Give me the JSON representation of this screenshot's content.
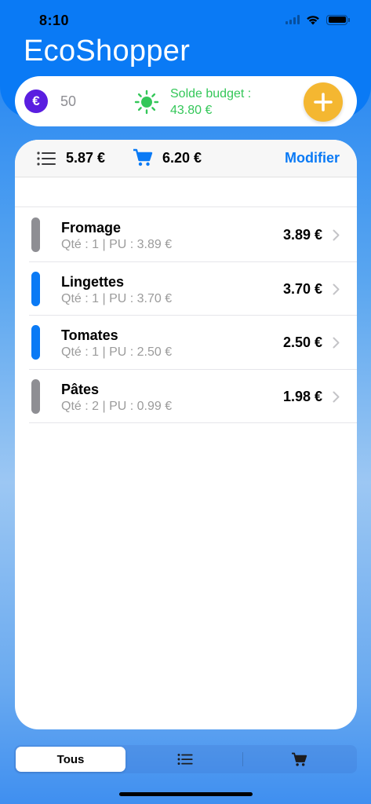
{
  "status": {
    "time": "8:10"
  },
  "app": {
    "title": "EcoShopper"
  },
  "budget": {
    "currency_symbol": "€",
    "amount": "50",
    "balance_label": "Solde budget :",
    "balance_value": "43.80 €"
  },
  "totals": {
    "list_total": "5.87 €",
    "cart_total": "6.20 €",
    "edit_label": "Modifier"
  },
  "items": [
    {
      "name": "Fromage",
      "detail": "Qté : 1  |  PU : 3.89 €",
      "price": "3.89 €",
      "color": "#8e8e93"
    },
    {
      "name": "Lingettes",
      "detail": "Qté : 1  |  PU : 3.70 €",
      "price": "3.70 €",
      "color": "#0a7af5"
    },
    {
      "name": "Tomates",
      "detail": "Qté : 1  |  PU : 2.50 €",
      "price": "2.50 €",
      "color": "#0a7af5"
    },
    {
      "name": "Pâtes",
      "detail": "Qté : 2  |  PU : 0.99 €",
      "price": "1.98 €",
      "color": "#8e8e93"
    }
  ],
  "tabs": {
    "all_label": "Tous"
  },
  "colors": {
    "accent": "#0a7af5",
    "success": "#34c759",
    "add_button": "#f4b731",
    "euro_badge": "#5a1ee0"
  }
}
